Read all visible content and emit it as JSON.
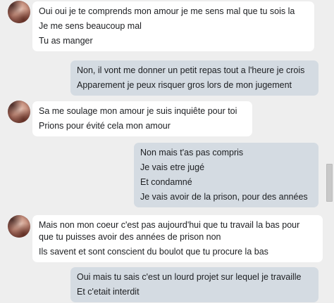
{
  "messages": [
    {
      "direction": "in",
      "lines": [
        "Oui oui je te comprends mon amour je me sens mal que tu sois la",
        "Je me sens beaucoup mal",
        "Tu as manger"
      ]
    },
    {
      "direction": "out",
      "lines": [
        "Non, il vont me donner un petit repas tout a l'heure je crois",
        "Apparement je peux risquer gros lors de mon jugement"
      ]
    },
    {
      "direction": "in",
      "lines": [
        "Sa me soulage mon amour je suis inquiête pour toi",
        "Prions pour évité cela mon amour"
      ]
    },
    {
      "direction": "out",
      "lines": [
        "Non mais t'as pas compris",
        "Je vais etre jugé",
        "Et condamné",
        "Je vais avoir de la prison, pour des années"
      ]
    },
    {
      "direction": "in",
      "lines": [
        "Mais non mon coeur c'est pas aujourd'hui que tu travail la bas pour que tu puisses avoir des années de prison non",
        "Ils savent et sont conscient du boulot que tu procure la bas"
      ]
    },
    {
      "direction": "out",
      "lines": [
        "Oui mais tu sais c'est un lourd projet sur lequel je travaille",
        "Et c'etait interdit"
      ]
    }
  ]
}
